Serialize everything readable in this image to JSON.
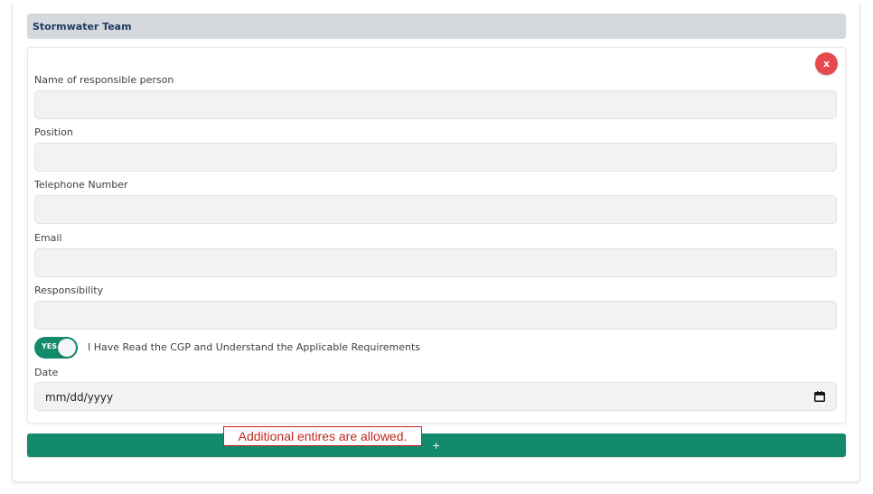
{
  "section": {
    "title": "Stormwater Team"
  },
  "entry": {
    "remove_label": "x",
    "fields": {
      "name": {
        "label": "Name of responsible person",
        "value": ""
      },
      "position": {
        "label": "Position",
        "value": ""
      },
      "telephone": {
        "label": "Telephone Number",
        "value": ""
      },
      "email": {
        "label": "Email",
        "value": ""
      },
      "responsibility": {
        "label": "Responsibility",
        "value": ""
      }
    },
    "acknowledge": {
      "toggle_state": "YES",
      "label": "I Have Read the CGP and Understand the Applicable Requirements"
    },
    "date": {
      "label": "Date",
      "placeholder": "mm/dd/yyyy"
    }
  },
  "add_button": {
    "label": "+"
  },
  "annotation": {
    "text": "Additional entires are allowed."
  },
  "colors": {
    "header_bg": "#d5d9de",
    "header_text": "#1f3b63",
    "accent_green": "#138a6c",
    "remove_red": "#e5484d",
    "annotation_red": "#c0271e"
  },
  "icons": {
    "remove": "close-icon",
    "date": "calendar-icon"
  }
}
